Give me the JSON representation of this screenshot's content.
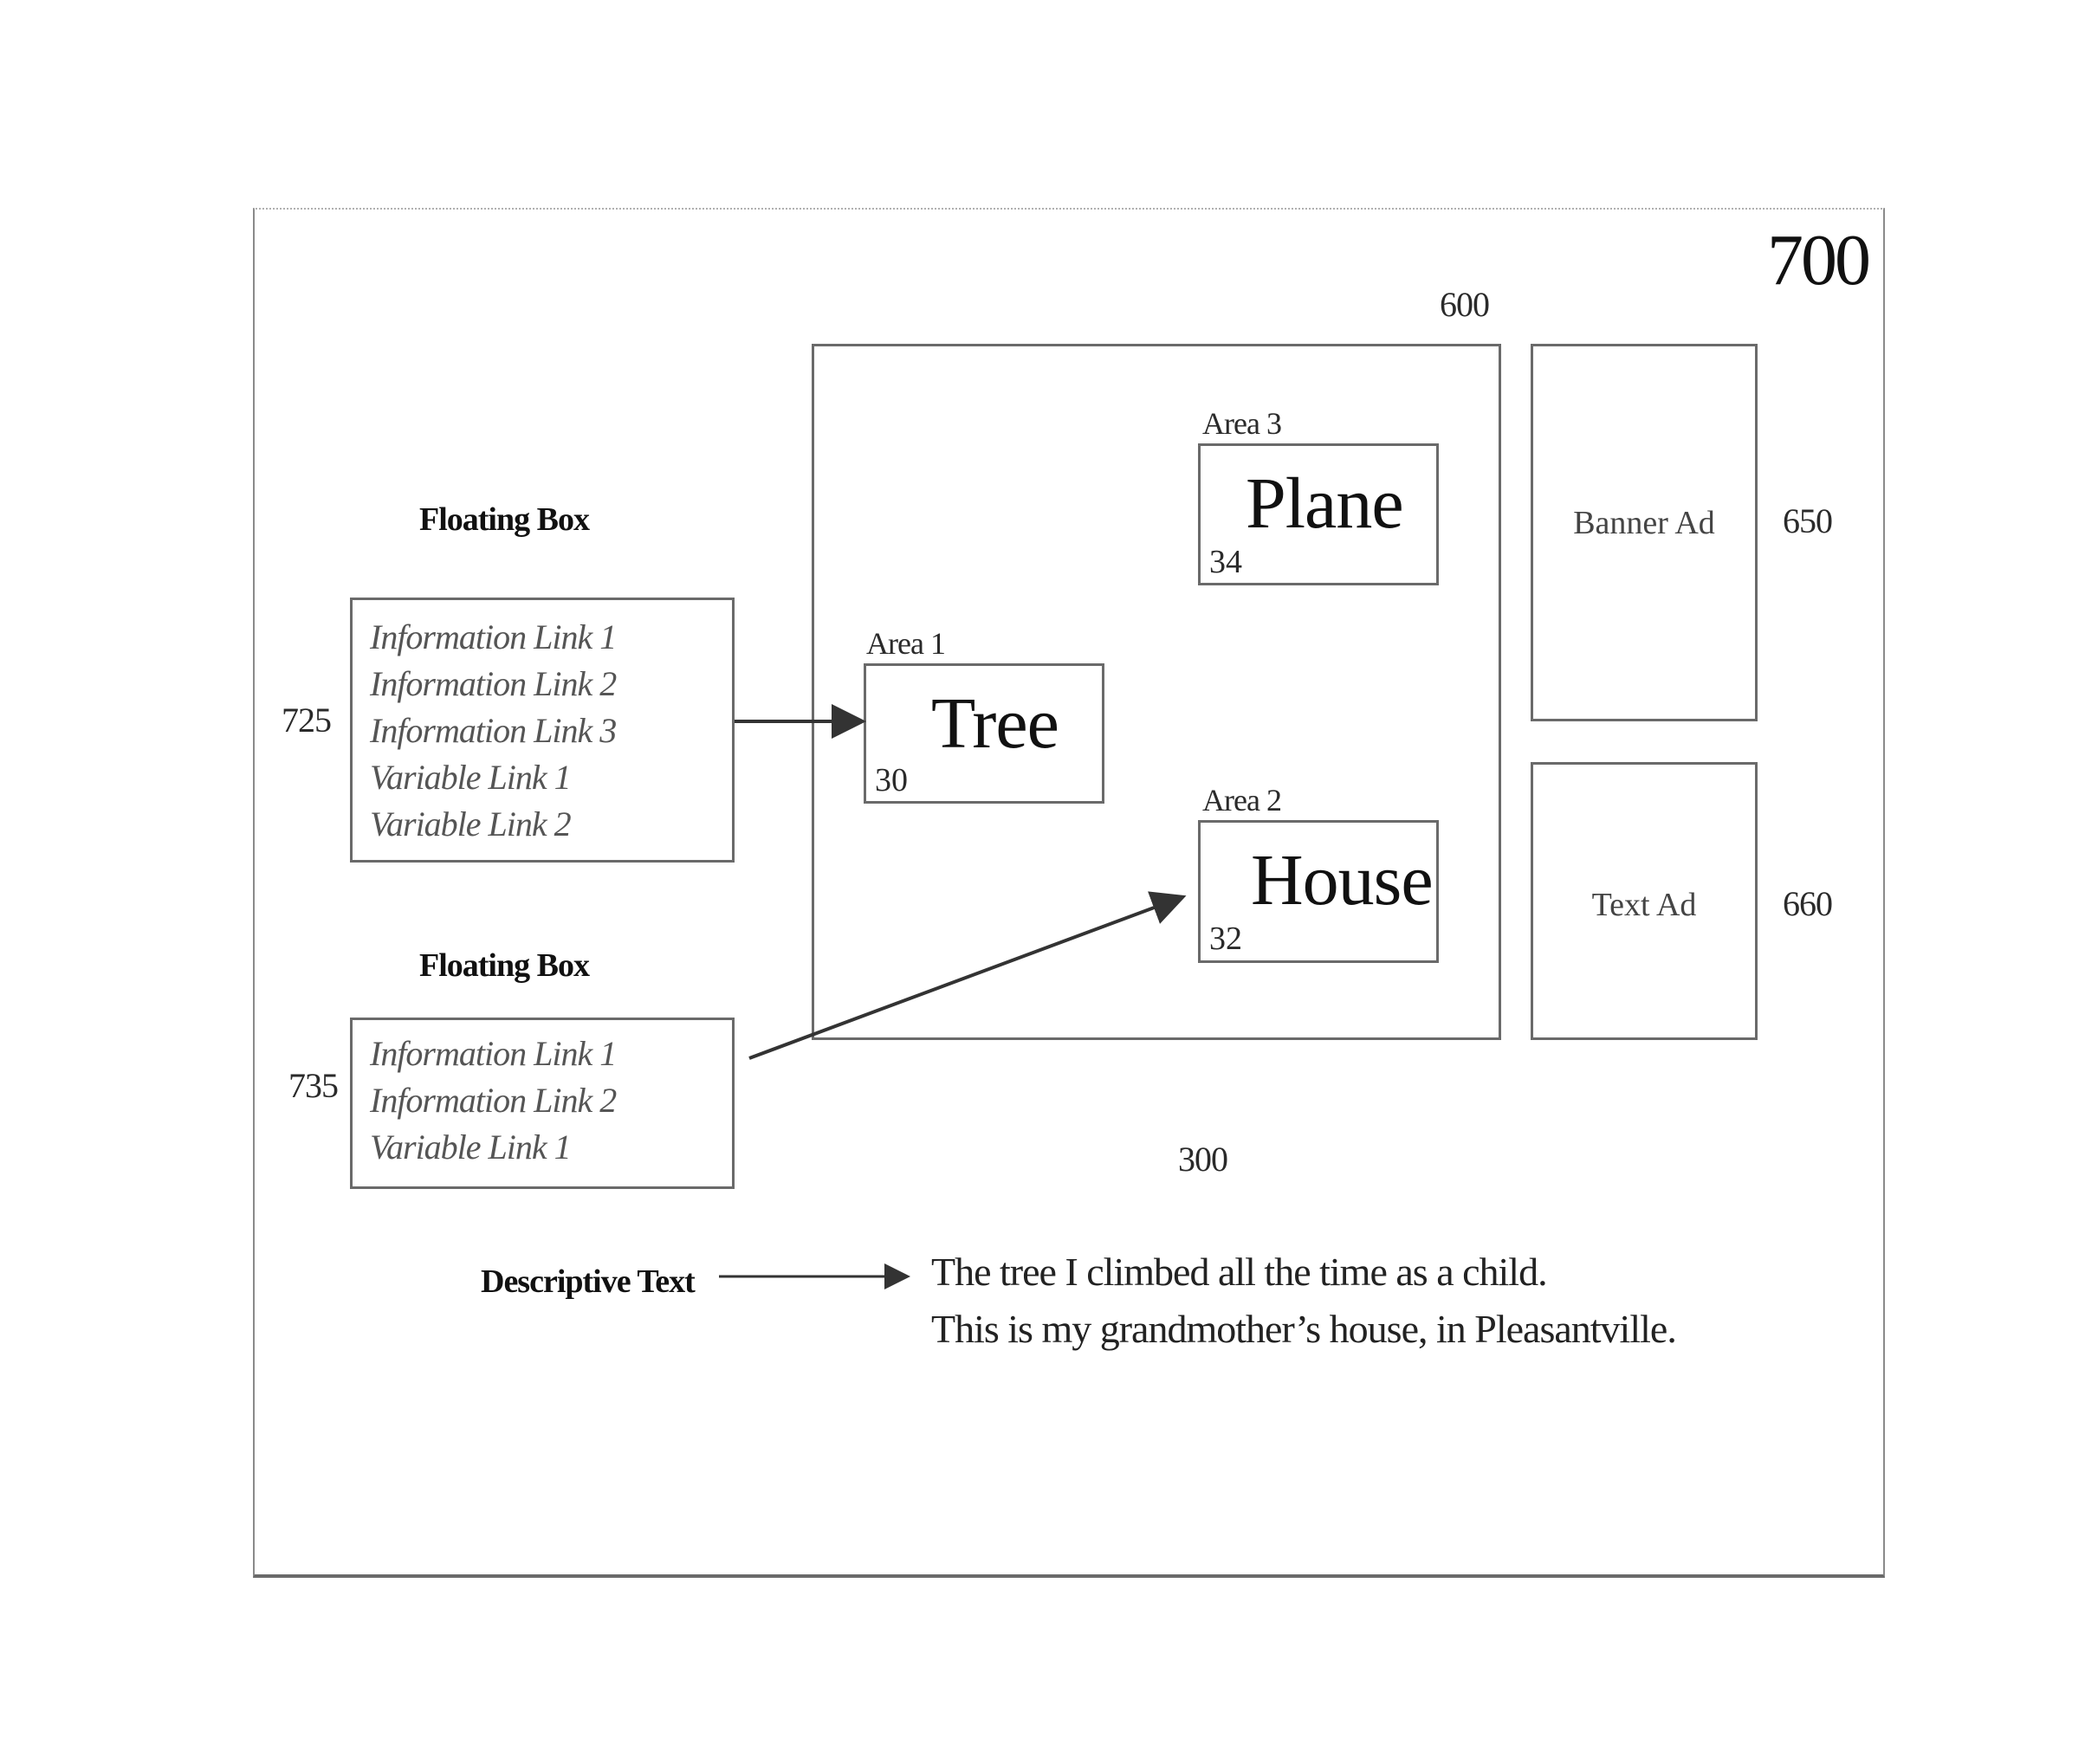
{
  "figure": {
    "frame_ref": "700",
    "page_ref": "300",
    "content_region": {
      "ref": "600",
      "areas": [
        {
          "id": "area-1",
          "label": "Area 1",
          "word": "Tree",
          "number": "30"
        },
        {
          "id": "area-2",
          "label": "Area 2",
          "word": "House",
          "number": "32"
        },
        {
          "id": "area-3",
          "label": "Area 3",
          "word": "Plane",
          "number": "34"
        }
      ]
    },
    "ads": [
      {
        "id": "banner-ad",
        "label": "Banner Ad",
        "ref": "650"
      },
      {
        "id": "text-ad",
        "label": "Text Ad",
        "ref": "660"
      }
    ],
    "floating_boxes": [
      {
        "title": "Floating Box",
        "ref": "725",
        "links": [
          "Information Link 1",
          "Information Link 2",
          "Information Link 3",
          "Variable Link 1",
          "Variable Link 2"
        ],
        "points_to": "Area 1"
      },
      {
        "title": "Floating Box",
        "ref": "735",
        "links": [
          "Information Link 1",
          "Information Link 2",
          "Variable Link 1"
        ],
        "points_to": "Area 2"
      }
    ],
    "descriptive_text": {
      "label": "Descriptive Text",
      "lines": [
        "The tree I climbed all the time as a child.",
        "This is my grandmother’s house, in Pleasantville."
      ]
    }
  },
  "colors": {
    "line": "#6a6a6a",
    "text": "#1a1a1a",
    "link_text": "#555555",
    "arrow": "#333333"
  }
}
